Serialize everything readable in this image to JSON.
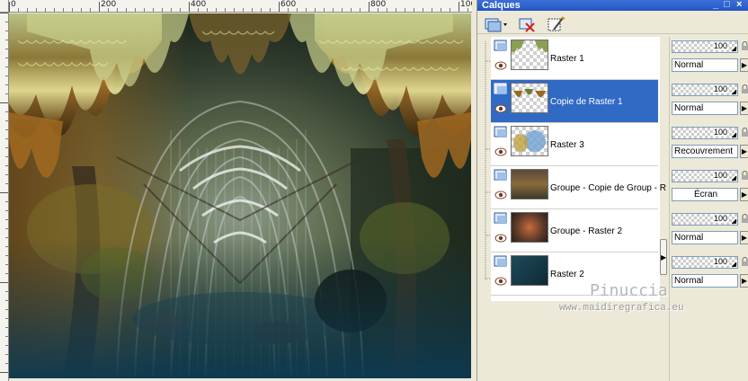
{
  "palette": {
    "title": "Calques",
    "window_controls": [
      "_",
      "□",
      "×"
    ]
  },
  "ruler": {
    "labels": [
      "0",
      "200",
      "400",
      "600",
      "800",
      "100"
    ]
  },
  "layers": [
    {
      "name": "Raster 1",
      "type": "raster",
      "selected": false,
      "opacity": "100",
      "blend": "Normal"
    },
    {
      "name": "Copie de Raster 1",
      "type": "raster",
      "selected": true,
      "opacity": "100",
      "blend": "Normal"
    },
    {
      "name": "Raster 3",
      "type": "raster",
      "selected": false,
      "opacity": "100",
      "blend": "Recouvrement"
    },
    {
      "name": "Groupe - Copie de Group - R",
      "type": "group",
      "selected": false,
      "opacity": "100",
      "blend": "Écran"
    },
    {
      "name": "Groupe - Raster 2",
      "type": "group",
      "selected": false,
      "opacity": "100",
      "blend": "Normal"
    },
    {
      "name": "Raster 2",
      "type": "raster",
      "selected": false,
      "opacity": "100",
      "blend": "Normal"
    }
  ],
  "credit": {
    "name": "Pinuccia",
    "site": "www.maidiregrafica.eu"
  },
  "colors": {
    "selection": "#316ac5",
    "title_bar": "#2456c4",
    "panel": "#ece9d8"
  },
  "icons": [
    "layer-type-icon",
    "eye-icon",
    "lock-icon",
    "new-layer-icon",
    "delete-layer-icon",
    "edit-mask-icon"
  ]
}
